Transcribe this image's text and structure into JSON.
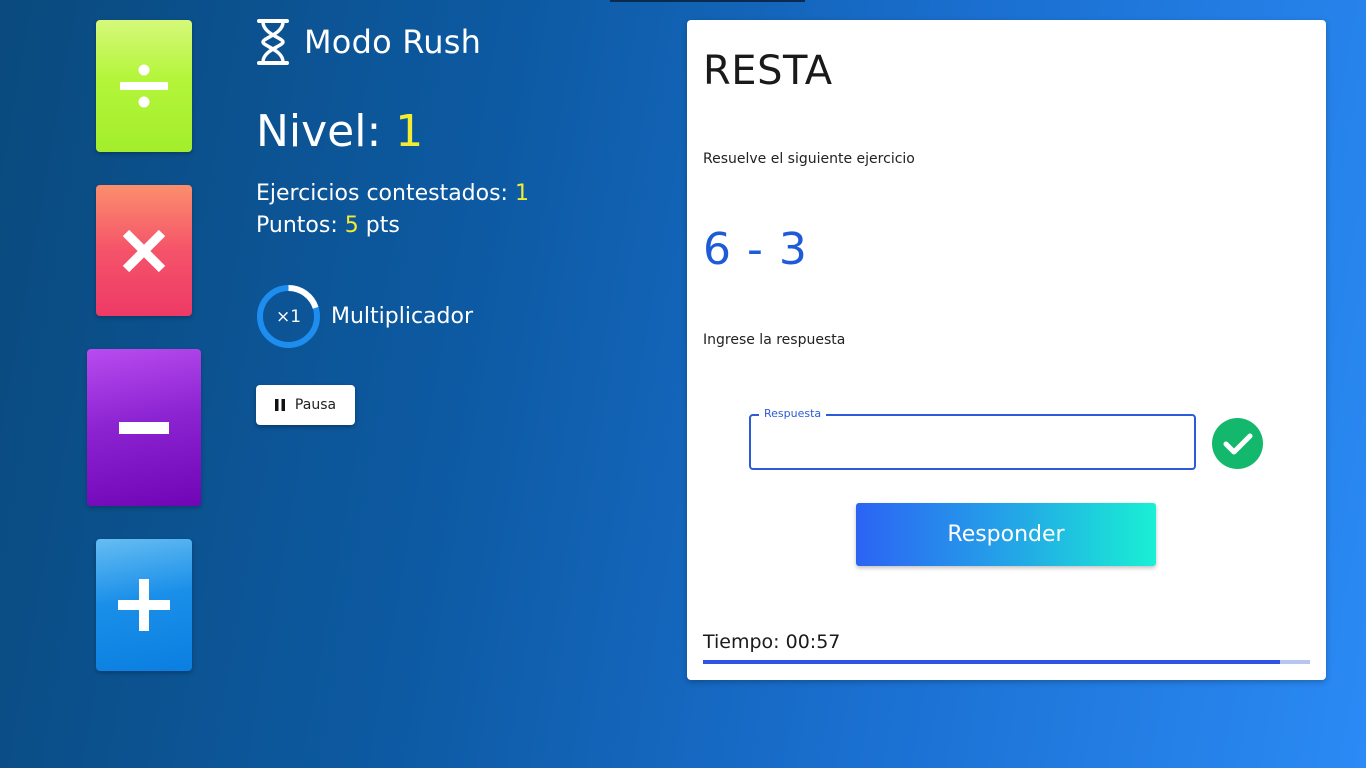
{
  "operations": [
    {
      "name": "division",
      "icon": "divide-icon"
    },
    {
      "name": "multiplication",
      "icon": "multiply-icon"
    },
    {
      "name": "subtraction",
      "icon": "minus-icon"
    },
    {
      "name": "addition",
      "icon": "plus-icon"
    }
  ],
  "mode": {
    "icon": "hourglass-icon",
    "title": "Modo Rush"
  },
  "level": {
    "label": "Nivel:",
    "value": "1"
  },
  "stats": {
    "answered_label": "Ejercicios contestados:",
    "answered_value": "1",
    "points_label": "Puntos:",
    "points_value": "5",
    "points_unit": "pts"
  },
  "multiplier": {
    "value_text": "×1",
    "label": "Multiplicador",
    "progress": 0.2
  },
  "pause_button": {
    "icon": "pause-icon",
    "label": "Pausa"
  },
  "exercise_card": {
    "title": "RESTA",
    "instruction": "Resuelve el siguiente ejercicio",
    "expression": "6 - 3",
    "answer_prompt": "Ingrese la respuesta",
    "answer_field": {
      "label": "Respuesta",
      "value": ""
    },
    "status_icon": "check-circle-icon",
    "submit_label": "Responder",
    "timer_label": "Tiempo: 00:57",
    "timer_progress": 0.95
  },
  "colors": {
    "highlight": "#f2ec32",
    "expression": "#1e5bd8",
    "success": "#14b86c",
    "accent": "#2d5ad8"
  }
}
